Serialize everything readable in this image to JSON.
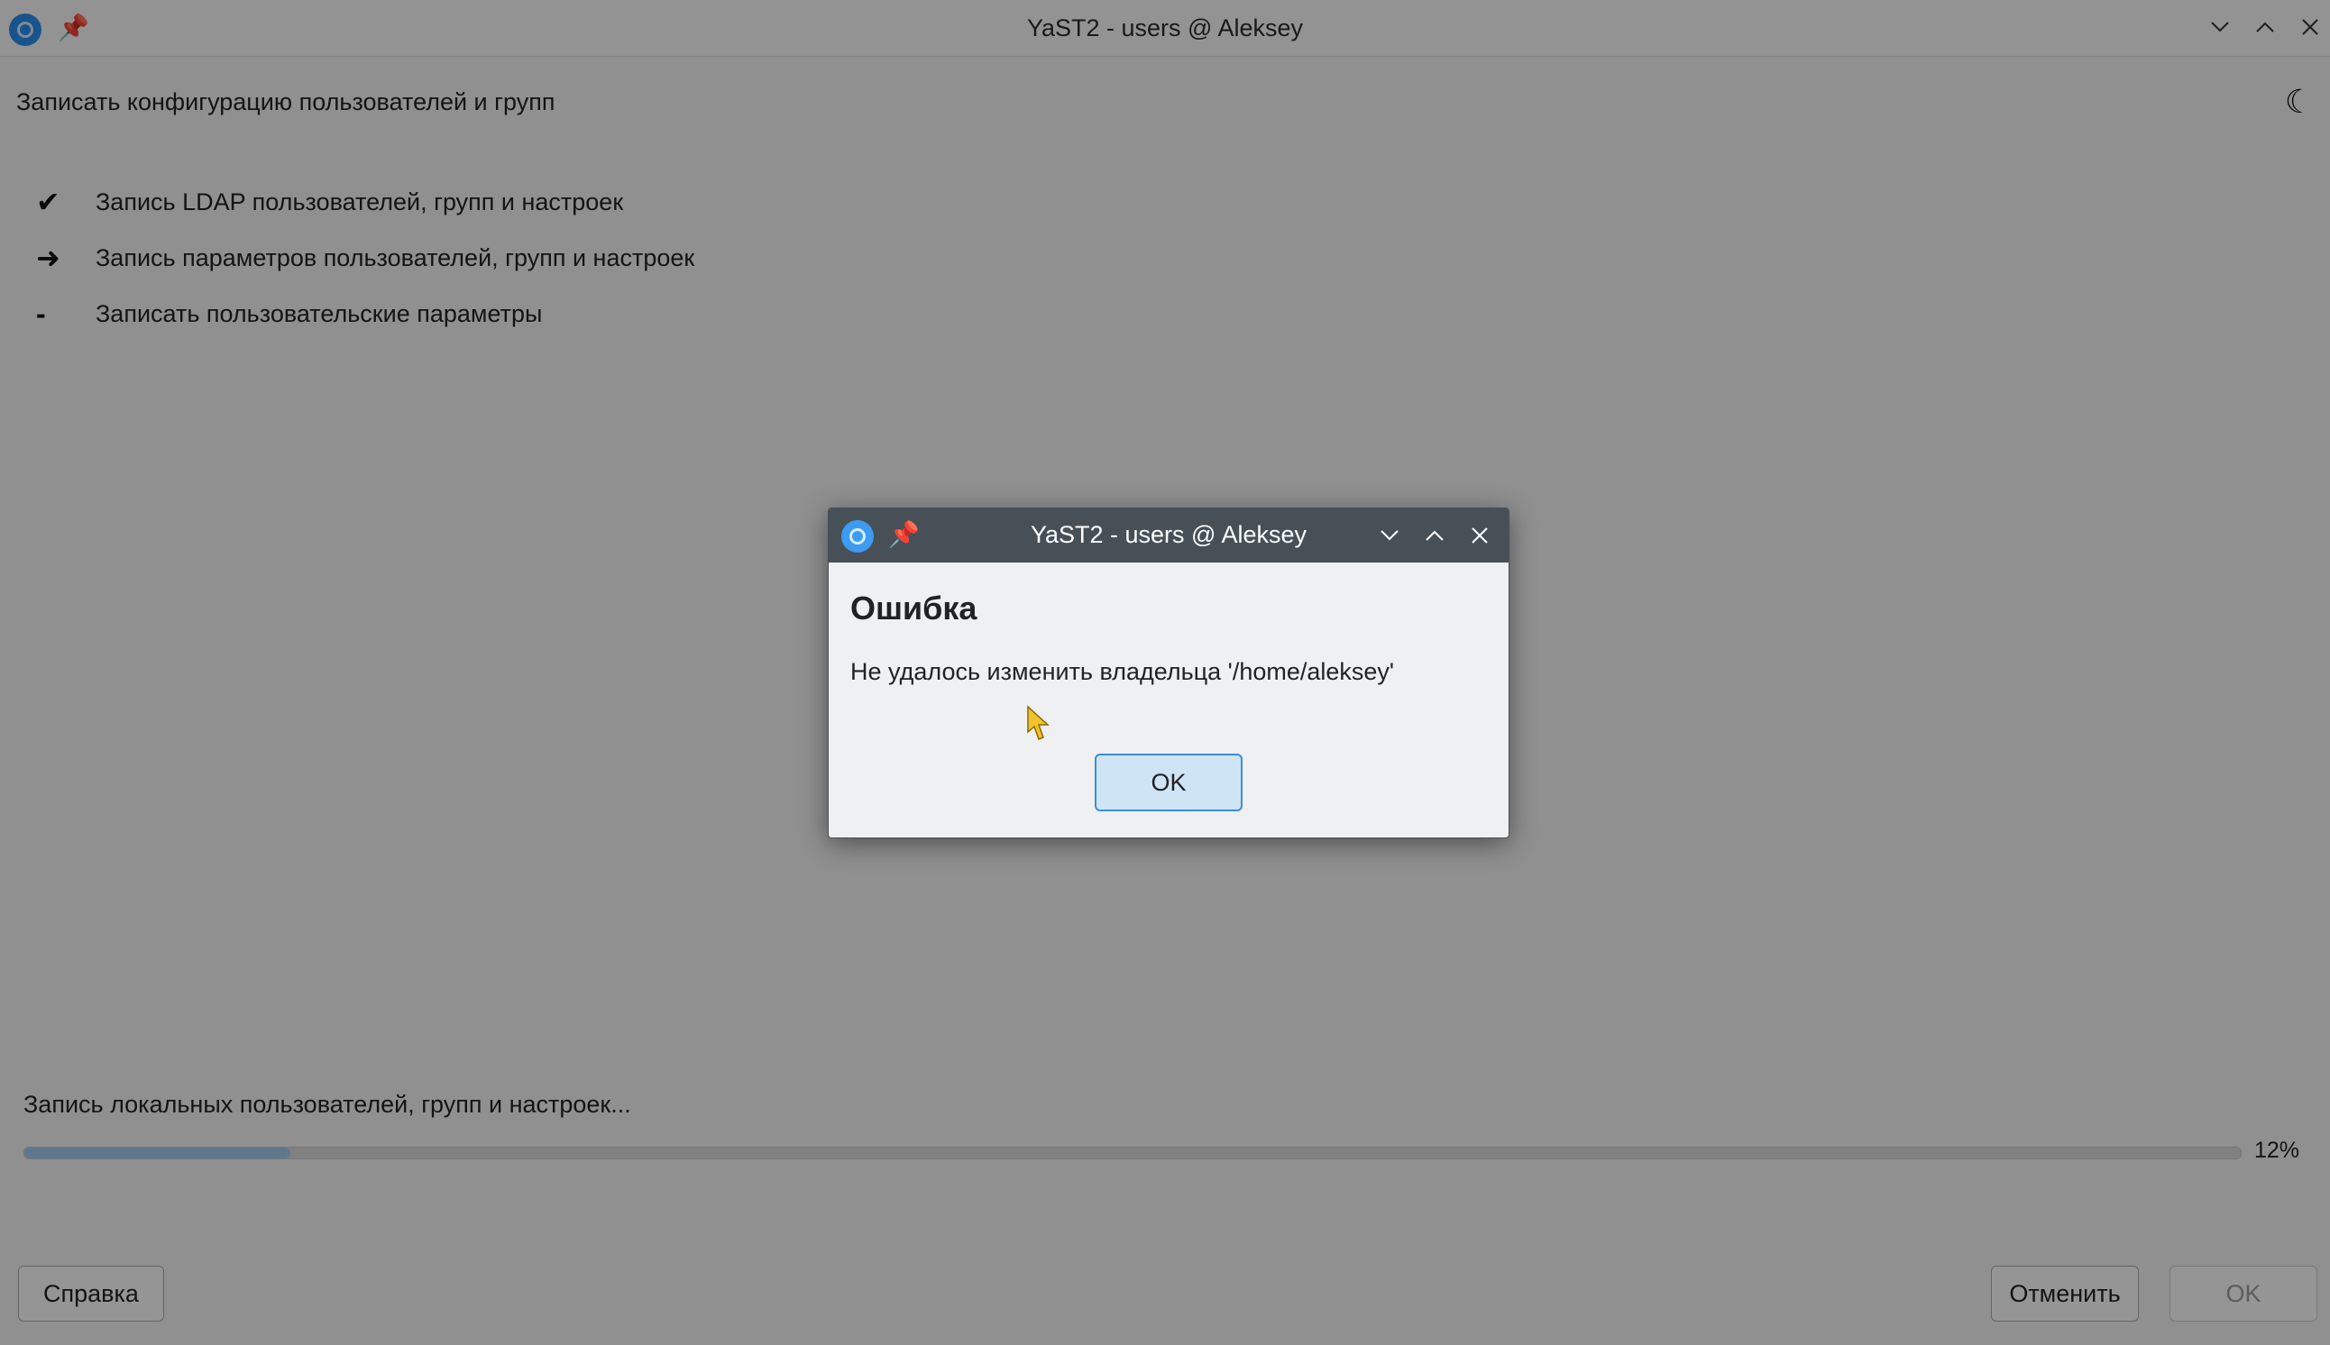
{
  "main_window": {
    "title": "YaST2 - users @ Aleksey",
    "heading": "Записать конфигурацию пользователей и групп",
    "steps": [
      {
        "mark": "✔",
        "label": "Запись LDAP пользователей, групп и настроек",
        "state": "done"
      },
      {
        "mark": "➜",
        "label": "Запись параметров пользователей, групп и настроек",
        "state": "current"
      },
      {
        "mark": "-",
        "label": "Записать пользовательские параметры",
        "state": "pending"
      }
    ],
    "progress": {
      "label": "Запись локальных пользователей, групп и настроек...",
      "percent": 12,
      "percent_text": "12%"
    },
    "buttons": {
      "help": "Справка",
      "cancel": "Отменить",
      "ok": "OK"
    }
  },
  "dialog": {
    "title": "YaST2 - users @ Aleksey",
    "heading": "Ошибка",
    "message": "Не удалось изменить владельца '/home/aleksey'",
    "ok_label": "OK"
  },
  "icons": {
    "app": "yast-logo-icon",
    "pin": "pin-icon",
    "minimize": "chevron-down-icon",
    "maximize": "chevron-up-icon",
    "close": "close-icon",
    "theme": "moon-icon",
    "pointer": "hand-pointer-icon"
  },
  "colors": {
    "dialog_titlebar": "#475057",
    "progress_fill": "#9fc9ec",
    "ok_focus": "#3a8fd8"
  }
}
